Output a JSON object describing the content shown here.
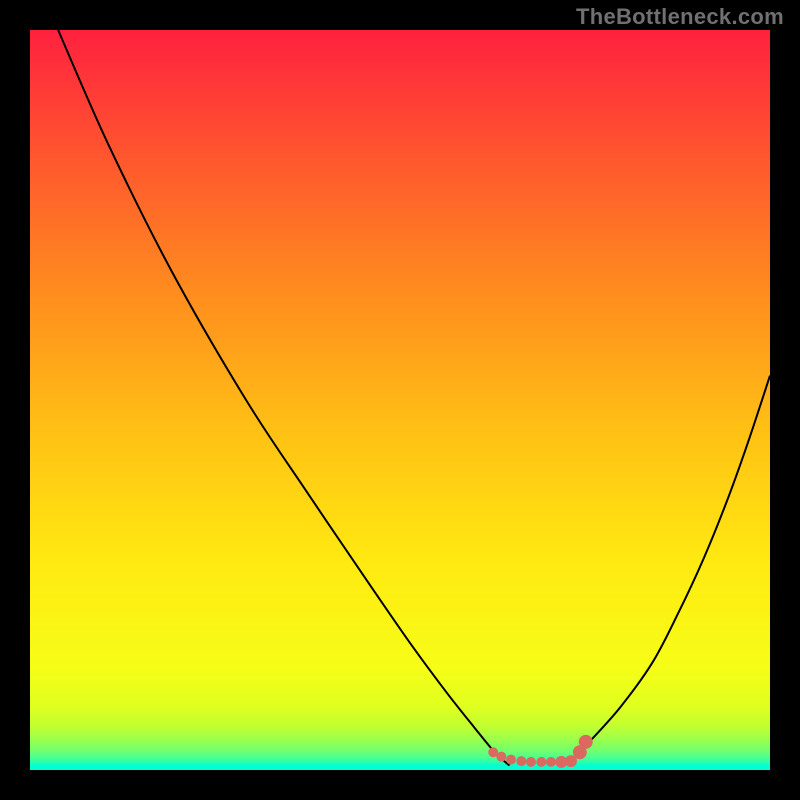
{
  "watermark": "TheBottleneck.com",
  "chart_data": {
    "type": "line",
    "title": "",
    "xlabel": "",
    "ylabel": "",
    "xlim": [
      0,
      100
    ],
    "ylim": [
      0,
      100
    ],
    "series": [
      {
        "name": "curve-a",
        "color": "#000000",
        "x": [
          3.8,
          10.6,
          19.2,
          29.2,
          37.4,
          45.6,
          51.4,
          56.2,
          60.0,
          62.8,
          64.8
        ],
        "y": [
          100,
          84.5,
          67.3,
          50.0,
          37.6,
          25.5,
          17.1,
          10.6,
          5.8,
          2.4,
          0.6
        ]
      },
      {
        "name": "curve-b",
        "color": "#000000",
        "x": [
          75.4,
          79.7,
          84.1,
          87.6,
          91.0,
          94.2,
          97.0,
          100.0
        ],
        "y": [
          3.6,
          8.4,
          14.5,
          21.2,
          28.5,
          36.4,
          44.2,
          53.3
        ]
      },
      {
        "name": "marker-trail",
        "color": "#db695f",
        "points": [
          {
            "x": 62.6,
            "y": 2.4,
            "r": 5
          },
          {
            "x": 63.7,
            "y": 1.8,
            "r": 5
          },
          {
            "x": 65.0,
            "y": 1.4,
            "r": 5
          },
          {
            "x": 66.4,
            "y": 1.2,
            "r": 5
          },
          {
            "x": 67.7,
            "y": 1.1,
            "r": 5
          },
          {
            "x": 69.1,
            "y": 1.1,
            "r": 5
          },
          {
            "x": 70.4,
            "y": 1.1,
            "r": 5
          },
          {
            "x": 71.8,
            "y": 1.1,
            "r": 6
          },
          {
            "x": 73.1,
            "y": 1.2,
            "r": 6
          },
          {
            "x": 74.3,
            "y": 2.4,
            "r": 7
          },
          {
            "x": 75.1,
            "y": 3.8,
            "r": 7
          }
        ]
      }
    ],
    "background": {
      "type": "gradient-stripes",
      "colors": [
        {
          "y": 100,
          "hex": "#ff213f"
        },
        {
          "y": 82,
          "hex": "#ff592d"
        },
        {
          "y": 64,
          "hex": "#ff8e1e"
        },
        {
          "y": 46,
          "hex": "#ffc014"
        },
        {
          "y": 28,
          "hex": "#ffea11"
        },
        {
          "y": 14,
          "hex": "#f6fd17"
        },
        {
          "y": 8.6,
          "hex": "#e0ff1f"
        },
        {
          "y": 6.1,
          "hex": "#c4ff2f"
        },
        {
          "y": 5.5,
          "hex": "#b9ff37"
        },
        {
          "y": 4.9,
          "hex": "#adff3f"
        },
        {
          "y": 4.3,
          "hex": "#9fff49"
        },
        {
          "y": 3.7,
          "hex": "#90ff55"
        },
        {
          "y": 3.1,
          "hex": "#7eff63"
        },
        {
          "y": 2.4,
          "hex": "#6bff74"
        },
        {
          "y": 1.8,
          "hex": "#53ff88"
        },
        {
          "y": 1.2,
          "hex": "#36ffa2"
        },
        {
          "y": 0.6,
          "hex": "#04ffd0"
        },
        {
          "y": 0.0,
          "hex": "#04ffd0"
        }
      ]
    }
  }
}
